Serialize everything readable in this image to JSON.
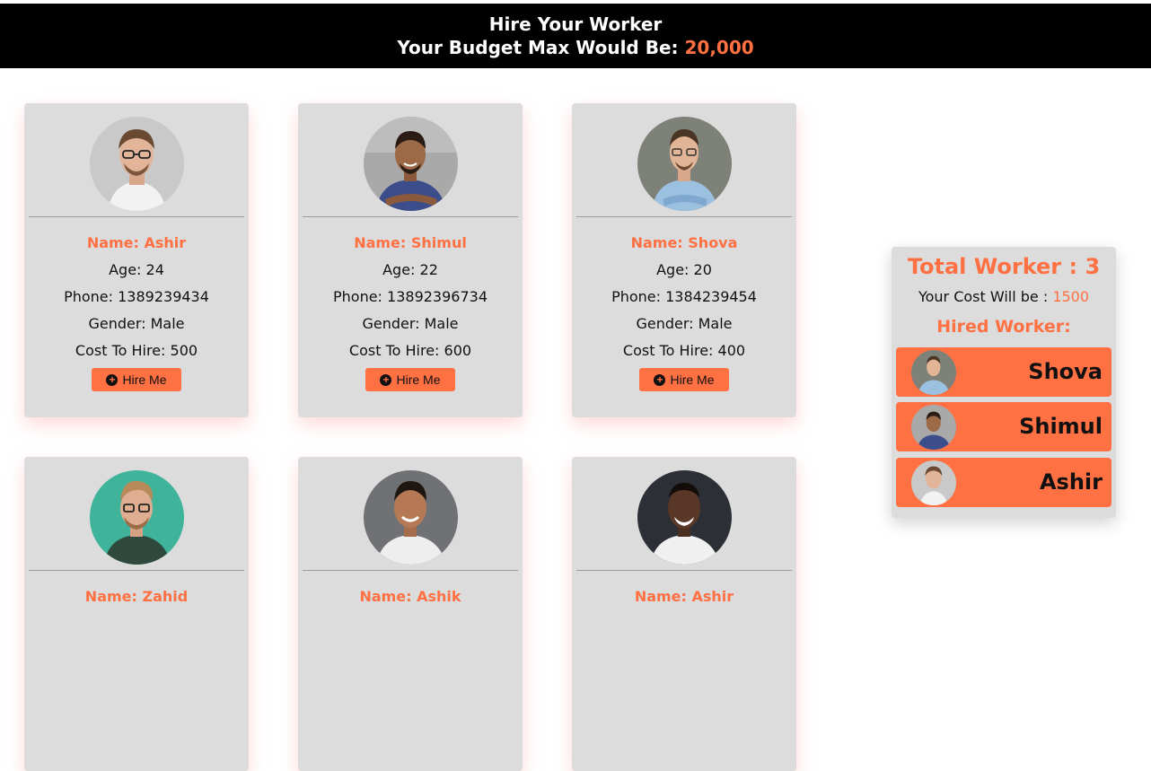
{
  "header": {
    "title": "Hire Your Worker",
    "budget_label": "Your Budget Max Would Be:",
    "budget_value": "20,000"
  },
  "cards": [
    {
      "name": "Name: Ashir",
      "age": "Age: 24",
      "phone": "Phone: 1389239434",
      "gender": "Gender: Male",
      "cost": "Cost To Hire: 500",
      "button": "Hire Me"
    },
    {
      "name": "Name: Shimul",
      "age": "Age: 22",
      "phone": "Phone: 13892396734",
      "gender": "Gender: Male",
      "cost": "Cost To Hire: 600",
      "button": "Hire Me"
    },
    {
      "name": "Name: Shova",
      "age": "Age: 20",
      "phone": "Phone: 1384239454",
      "gender": "Gender: Male",
      "cost": "Cost To Hire: 400",
      "button": "Hire Me"
    },
    {
      "name": "Name: Zahid"
    },
    {
      "name": "Name: Ashik"
    },
    {
      "name": "Name: Ashir"
    }
  ],
  "summary": {
    "total": "Total Worker : 3",
    "cost_label": "Your Cost Will be :",
    "cost_value": "1500",
    "hired_title": "Hired Worker:",
    "workers": [
      "Shova",
      "Shimul",
      "Ashir"
    ]
  },
  "colors": {
    "accent": "#ff7043",
    "card_bg": "#dcdcdc",
    "header_bg": "#000000"
  }
}
